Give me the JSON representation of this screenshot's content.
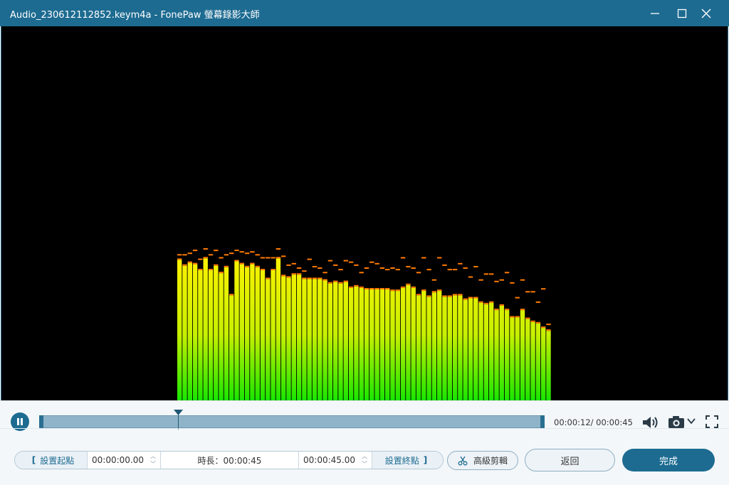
{
  "window": {
    "title": "Audio_230612112852.keym4a  -  FonePaw 螢幕錄影大師",
    "controls": [
      "minimize-icon",
      "maximize-icon",
      "close-icon"
    ]
  },
  "visualizer": {
    "bars": [
      0.95,
      0.91,
      0.93,
      0.92,
      0.88,
      0.96,
      0.88,
      0.91,
      0.86,
      0.9,
      0.71,
      0.94,
      0.92,
      0.9,
      0.92,
      0.9,
      0.88,
      0.82,
      0.88,
      0.96,
      0.84,
      0.83,
      0.85,
      0.85,
      0.82,
      0.82,
      0.82,
      0.82,
      0.81,
      0.79,
      0.8,
      0.79,
      0.8,
      0.76,
      0.77,
      0.76,
      0.75,
      0.75,
      0.75,
      0.75,
      0.75,
      0.74,
      0.74,
      0.76,
      0.78,
      0.76,
      0.71,
      0.74,
      0.7,
      0.73,
      0.74,
      0.7,
      0.7,
      0.71,
      0.71,
      0.68,
      0.69,
      0.69,
      0.66,
      0.65,
      0.66,
      0.61,
      0.64,
      0.61,
      0.56,
      0.56,
      0.61,
      0.55,
      0.53,
      0.52,
      0.49,
      0.47
    ],
    "peaks": [
      0.96,
      0.96,
      0.97,
      0.99,
      0.93,
      1.0,
      0.96,
      0.99,
      0.94,
      0.96,
      0.97,
      0.99,
      0.98,
      0.97,
      0.98,
      0.96,
      0.94,
      0.94,
      0.94,
      1.0,
      0.95,
      0.89,
      0.9,
      0.87,
      0.85,
      0.93,
      0.88,
      0.87,
      0.84,
      0.92,
      0.89,
      0.86,
      0.92,
      0.91,
      0.89,
      0.84,
      0.87,
      0.91,
      0.9,
      0.87,
      0.86,
      0.87,
      0.86,
      0.94,
      0.88,
      0.87,
      0.84,
      0.94,
      0.86,
      0.79,
      0.94,
      0.89,
      0.86,
      0.86,
      0.9,
      0.87,
      0.81,
      0.88,
      0.79,
      0.83,
      0.83,
      0.78,
      0.79,
      0.84,
      0.77,
      0.67,
      0.79,
      0.71,
      0.71,
      0.64,
      0.73,
      0.49
    ],
    "colors": {
      "top": "#fff200",
      "mid": "#c8f000",
      "bottom": "#19e600",
      "peak": "#ff7a00"
    }
  },
  "player": {
    "state": "playing",
    "pause_icon": "pause-icon",
    "progress": 0.27,
    "time_current": "00:00:12",
    "time_total": "00:00:45",
    "time_display": "00:00:12/ 00:00:45",
    "volume_icon": "speaker-icon",
    "snapshot_icon": "camera-icon",
    "snapshot_menu_icon": "chevron-down-icon",
    "fullscreen_icon": "fullscreen-icon"
  },
  "trim": {
    "set_start_label": "設置起點",
    "start_value": "00:00:00.00",
    "duration_label": "時長：00:00:45",
    "end_value": "00:00:45.00",
    "set_end_label": "設置終點",
    "advanced_label": "高級剪輯",
    "advanced_icon": "scissors-icon"
  },
  "actions": {
    "back_label": "返回",
    "done_label": "完成"
  },
  "colors": {
    "accent": "#1d6b91",
    "titlebar": "#1d6b91"
  }
}
